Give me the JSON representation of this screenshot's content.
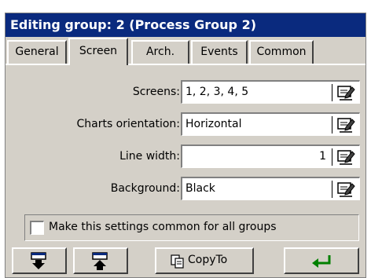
{
  "window": {
    "title": "Editing group: 2 (Process Group 2)",
    "title_bg": "#0a2a7e"
  },
  "tabs": [
    {
      "label": "General",
      "active": false
    },
    {
      "label": "Screen",
      "active": true
    },
    {
      "label": "Arch.",
      "active": false
    },
    {
      "label": "Events",
      "active": false
    },
    {
      "label": "Common",
      "active": false
    }
  ],
  "form": {
    "screens": {
      "label": "Screens:",
      "value": "1, 2, 3, 4, 5"
    },
    "orientation": {
      "label": "Charts orientation:",
      "value": "Horizontal"
    },
    "line_width": {
      "label": "Line width:",
      "value": "1"
    },
    "background": {
      "label": "Background:",
      "value": "Black"
    }
  },
  "common_checkbox": {
    "label": "Make this settings common for all groups",
    "checked": false
  },
  "toolbar": {
    "move_down_icon": "move-down-icon",
    "move_up_icon": "move-up-icon",
    "copy_label": "CopyTo",
    "enter_icon": "enter-icon",
    "enter_color": "#008000"
  }
}
